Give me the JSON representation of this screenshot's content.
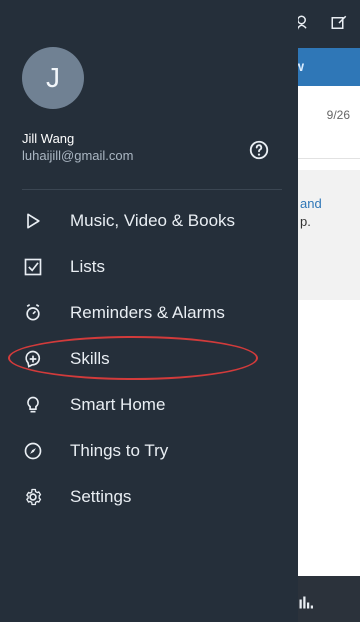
{
  "background": {
    "banner_fragment": "w",
    "card_date": "9/26",
    "card_link_fragment": "and",
    "card_text_fragment": "p."
  },
  "drawer": {
    "avatar_initial": "J",
    "user_name": "Jill Wang",
    "user_email": "luhaijill@gmail.com",
    "menu": [
      {
        "label": "Music, Video & Books",
        "icon": "play-icon"
      },
      {
        "label": "Lists",
        "icon": "checkbox-icon"
      },
      {
        "label": "Reminders & Alarms",
        "icon": "alarm-clock-icon"
      },
      {
        "label": "Skills",
        "icon": "skills-plus-icon"
      },
      {
        "label": "Smart Home",
        "icon": "lightbulb-icon"
      },
      {
        "label": "Things to Try",
        "icon": "compass-icon"
      },
      {
        "label": "Settings",
        "icon": "gear-icon"
      }
    ]
  },
  "colors": {
    "drawer_bg": "#252f3a",
    "banner_blue": "#2f77b7",
    "annotation_red": "#d23b3b"
  }
}
